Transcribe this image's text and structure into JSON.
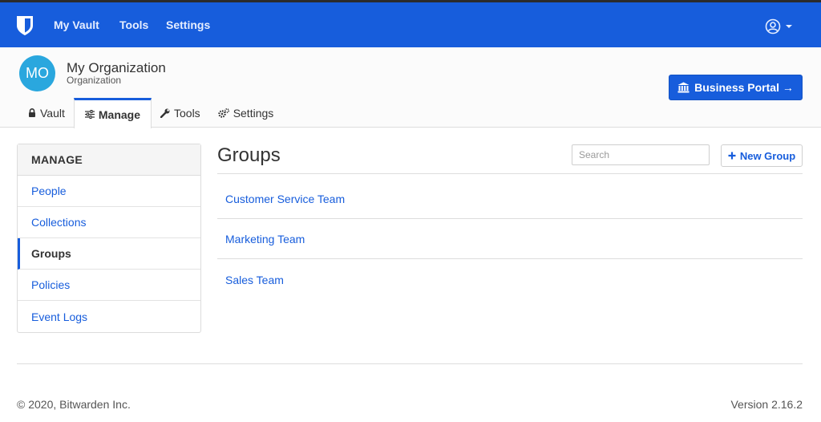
{
  "navbar": {
    "logo_icon": "bitwarden-shield-icon",
    "links": [
      "My Vault",
      "Tools",
      "Settings"
    ],
    "account_icon": "user-circle-icon"
  },
  "org": {
    "avatar_initials": "MO",
    "name": "My Organization",
    "subtitle": "Organization",
    "portal_button": "Business Portal →",
    "portal_icon": "bank-icon"
  },
  "tabs": [
    {
      "label": "Vault",
      "icon": "lock-icon"
    },
    {
      "label": "Manage",
      "icon": "sliders-icon",
      "active": true
    },
    {
      "label": "Tools",
      "icon": "wrench-icon"
    },
    {
      "label": "Settings",
      "icon": "cogs-icon"
    }
  ],
  "sidebar": {
    "heading": "MANAGE",
    "items": [
      {
        "label": "People"
      },
      {
        "label": "Collections"
      },
      {
        "label": "Groups",
        "active": true
      },
      {
        "label": "Policies"
      },
      {
        "label": "Event Logs"
      }
    ]
  },
  "main": {
    "title": "Groups",
    "search_placeholder": "Search",
    "new_button": "New Group",
    "groups": [
      "Customer Service Team",
      "Marketing Team",
      "Sales Team"
    ]
  },
  "footer": {
    "copyright": "© 2020, Bitwarden Inc.",
    "version": "Version 2.16.2"
  },
  "colors": {
    "brand": "#175ddc",
    "avatar": "#2aa7de"
  }
}
